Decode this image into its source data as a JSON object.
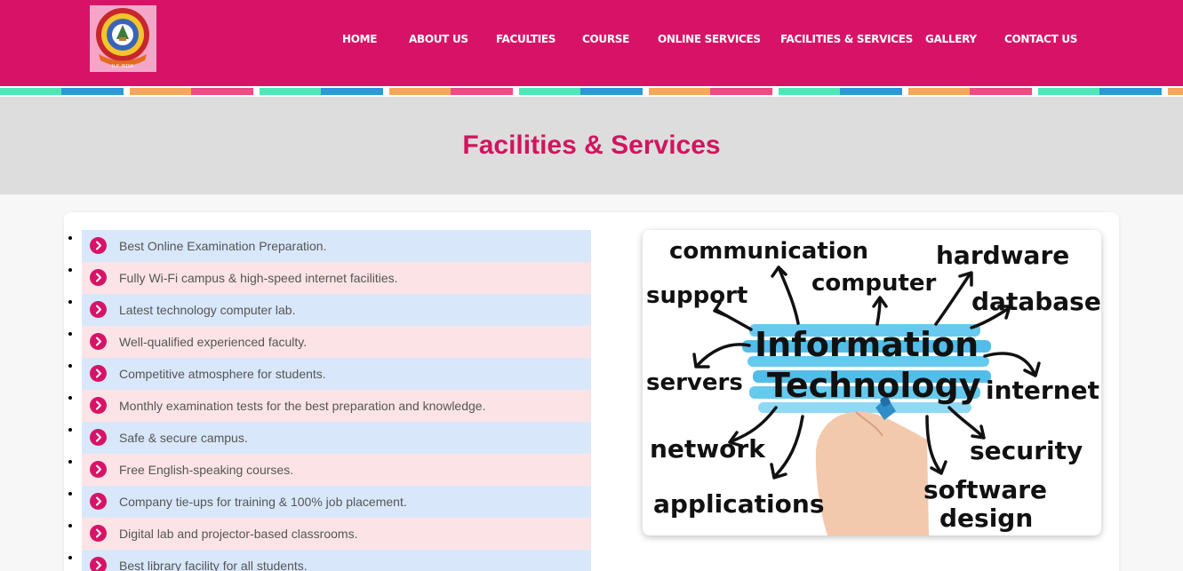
{
  "header": {
    "logo_text": "NIRMALA SHRI WELFARE EDUCATION SOCIETY NSWES U.P. INDIA",
    "nav": [
      {
        "label": "HOME"
      },
      {
        "label": "ABOUT US"
      },
      {
        "label": "FACULTIES"
      },
      {
        "label": "COURSE"
      },
      {
        "label": "ONLINE SERVICES"
      },
      {
        "label": "FACILITIES & SERVICES"
      },
      {
        "label": "GALLERY"
      },
      {
        "label": "CONTACT US"
      }
    ]
  },
  "banner": {
    "title": "Facilities & Services"
  },
  "facilities": [
    "Best Online Examination Preparation.",
    "Fully Wi-Fi campus & high-speed internet facilities.",
    "Latest technology computer lab.",
    "Well-qualified experienced faculty.",
    "Competitive atmosphere for students.",
    "Monthly examination tests for the best preparation and knowledge.",
    "Safe & secure campus.",
    "Free English-speaking courses.",
    "Company tie-ups for training & 100% job placement.",
    "Digital lab and projector-based classrooms.",
    "Best library facility for all students."
  ],
  "it_image": {
    "center_line1": "Information",
    "center_line2": "Technology",
    "words": [
      "communication",
      "computer",
      "hardware",
      "support",
      "database",
      "servers",
      "internet",
      "network",
      "security",
      "applications",
      "software",
      "design"
    ]
  },
  "colors": {
    "brand_pink": "#d81367",
    "title_pink": "#d2145e",
    "row_blue": "#d9e7fb",
    "row_pink": "#fce4e6",
    "stripe": [
      "#4ce8b8",
      "#2a9ad6",
      "#f4a75a",
      "#ef4a84"
    ]
  }
}
